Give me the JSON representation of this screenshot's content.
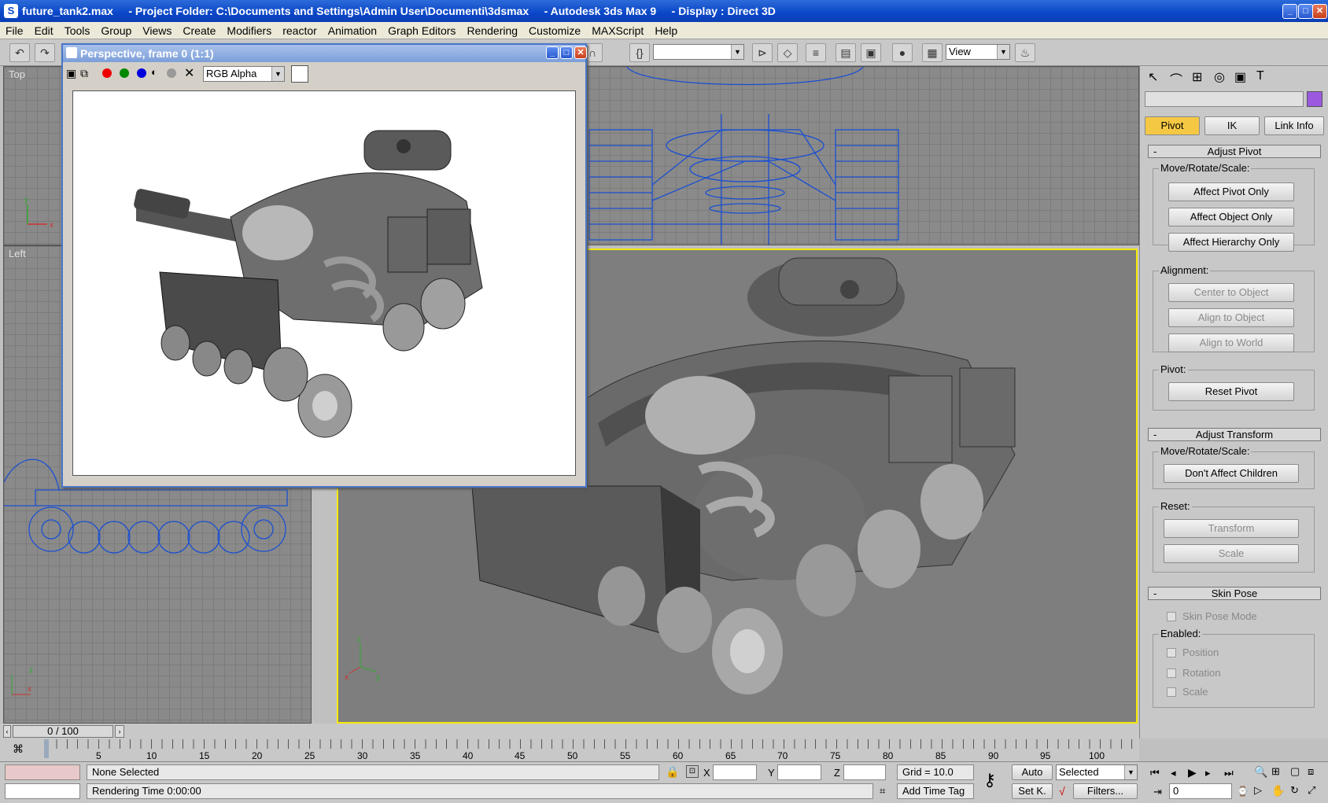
{
  "window": {
    "title": "future_tank2.max     - Project Folder: C:\\Documents and Settings\\Admin User\\Documenti\\3dsmax     - Autodesk 3ds Max 9     - Display : Direct 3D",
    "app_icon": "3dsmax-logo-icon"
  },
  "menu": [
    "File",
    "Edit",
    "Tools",
    "Group",
    "Views",
    "Create",
    "Modifiers",
    "reactor",
    "Animation",
    "Graph Editors",
    "Rendering",
    "Customize",
    "MAXScript",
    "Help"
  ],
  "toolbar": {
    "view_combo": "View"
  },
  "viewports": {
    "top": "Top",
    "left": "Left"
  },
  "render_window": {
    "title": "Perspective, frame 0 (1:1)",
    "channel_select": "RGB Alpha"
  },
  "command_panel": {
    "tabs": {
      "pivot": "Pivot",
      "ik": "IK",
      "link_info": "Link Info"
    },
    "accent_color": "#9b59e0",
    "adjust_pivot": {
      "title": "Adjust Pivot",
      "move_group": "Move/Rotate/Scale:",
      "affect_pivot_only": "Affect Pivot Only",
      "affect_object_only": "Affect Object Only",
      "affect_hierarchy_only": "Affect Hierarchy Only",
      "alignment_group": "Alignment:",
      "center_to_object": "Center to Object",
      "align_to_object": "Align to Object",
      "align_to_world": "Align to World",
      "pivot_group": "Pivot:",
      "reset_pivot": "Reset Pivot"
    },
    "adjust_transform": {
      "title": "Adjust Transform",
      "move_group": "Move/Rotate/Scale:",
      "dont_affect_children": "Don't Affect Children",
      "reset_group": "Reset:",
      "transform": "Transform",
      "scale": "Scale"
    },
    "skin_pose": {
      "title": "Skin Pose",
      "skin_pose_mode": "Skin Pose Mode",
      "enabled_group": "Enabled:",
      "position": "Position",
      "rotation": "Rotation",
      "scale": "Scale"
    }
  },
  "timeline": {
    "slider": "0 / 100",
    "ticks": [
      "5",
      "10",
      "15",
      "20",
      "25",
      "30",
      "35",
      "40",
      "45",
      "50",
      "55",
      "60",
      "65",
      "70",
      "75",
      "80",
      "85",
      "90",
      "95",
      "100"
    ]
  },
  "status": {
    "selection": "None Selected",
    "prompt": "Rendering Time  0:00:00",
    "x_label": "X",
    "y_label": "Y",
    "z_label": "Z",
    "grid": "Grid = 10.0",
    "add_time_tag": "Add Time Tag",
    "auto": "Auto",
    "set_key": "Set K.",
    "key_filter": "Selected",
    "filters": "Filters...",
    "frame": "0"
  }
}
